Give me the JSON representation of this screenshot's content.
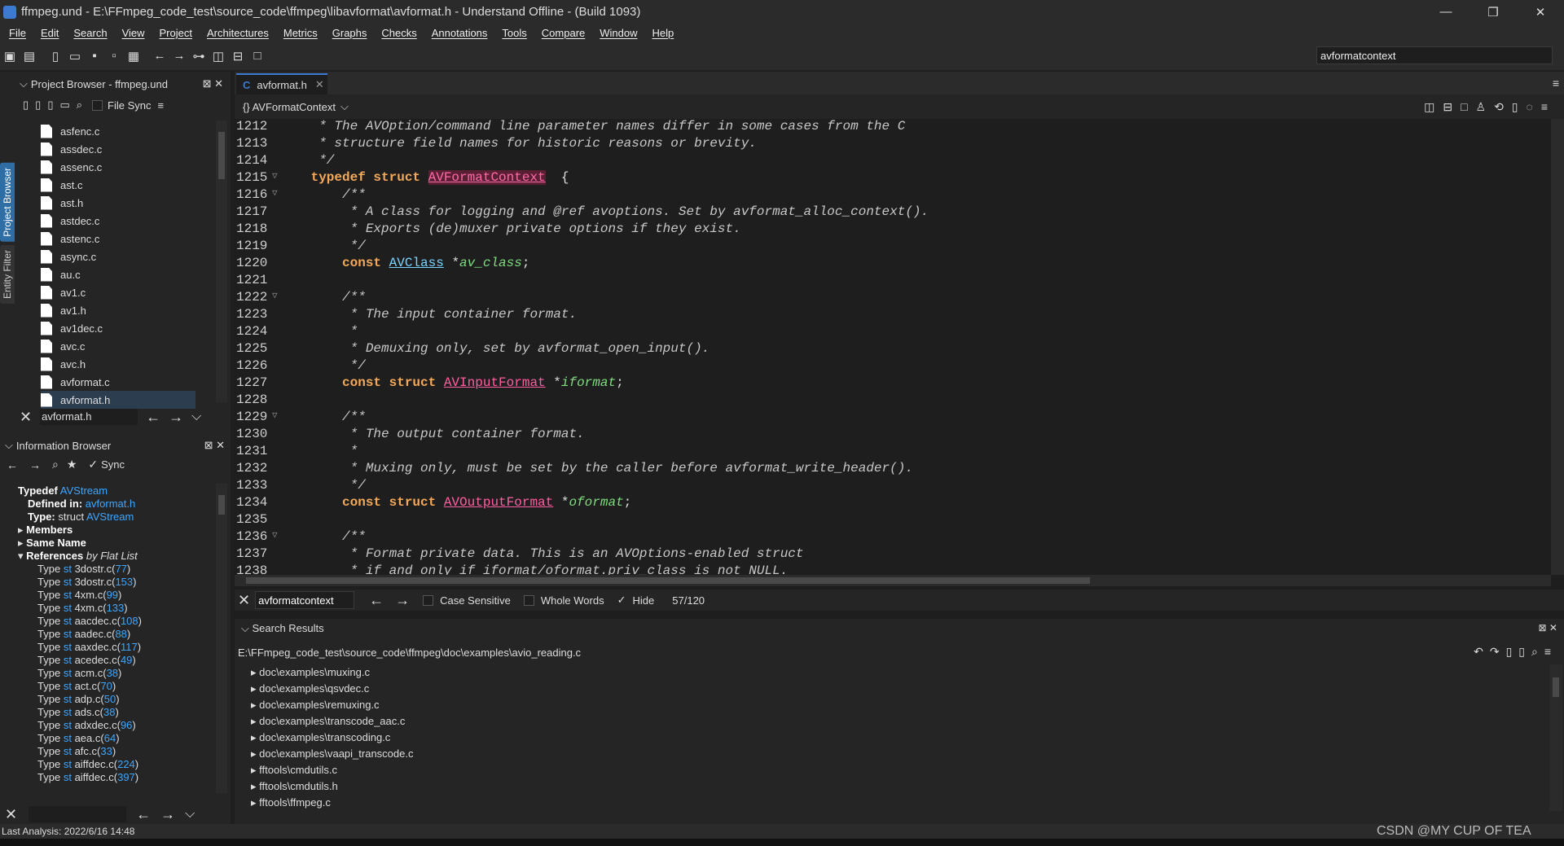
{
  "window": {
    "title": "ffmpeg.und - E:\\FFmpeg_code_test\\source_code\\ffmpeg\\libavformat\\avformat.h - Understand Offline - (Build 1093)",
    "minimize": "—",
    "restore": "❐",
    "close": "✕"
  },
  "menu": [
    "File",
    "Edit",
    "Search",
    "View",
    "Project",
    "Architectures",
    "Metrics",
    "Graphs",
    "Checks",
    "Annotations",
    "Tools",
    "Compare",
    "Window",
    "Help"
  ],
  "global_search": {
    "value": "avformatcontext"
  },
  "project_browser": {
    "title": "Project Browser - ffmpeg.und",
    "file_sync": "File Sync",
    "files": [
      "asfenc.c",
      "assdec.c",
      "assenc.c",
      "ast.c",
      "ast.h",
      "astdec.c",
      "astenc.c",
      "async.c",
      "au.c",
      "av1.c",
      "av1.h",
      "av1dec.c",
      "avc.c",
      "avc.h",
      "avformat.c",
      "avformat.h"
    ],
    "selected": "avformat.h",
    "filter_value": "avformat.h"
  },
  "vertical_tabs": [
    "Project Browser",
    "Entity Filter"
  ],
  "info_browser": {
    "title": "Information Browser",
    "sync": "Sync",
    "typedef_label": "Typedef",
    "typedef_name": "AVStream",
    "defined_in_label": "Defined in:",
    "defined_in": "avformat.h",
    "type_label": "Type:",
    "type_prefix": "struct",
    "type_name": "AVStream",
    "members": "Members",
    "same_name": "Same Name",
    "references": "References",
    "references_suffix": "by Flat List",
    "ref_rows": [
      {
        "label": "Type",
        "st": "st",
        "file": "3dostr.c",
        "line": "77"
      },
      {
        "label": "Type",
        "st": "st",
        "file": "3dostr.c",
        "line": "153"
      },
      {
        "label": "Type",
        "st": "st",
        "file": "4xm.c",
        "line": "99"
      },
      {
        "label": "Type",
        "st": "st",
        "file": "4xm.c",
        "line": "133"
      },
      {
        "label": "Type",
        "st": "st",
        "file": "aacdec.c",
        "line": "108"
      },
      {
        "label": "Type",
        "st": "st",
        "file": "aadec.c",
        "line": "88"
      },
      {
        "label": "Type",
        "st": "st",
        "file": "aaxdec.c",
        "line": "117"
      },
      {
        "label": "Type",
        "st": "st",
        "file": "acedec.c",
        "line": "49"
      },
      {
        "label": "Type",
        "st": "st",
        "file": "acm.c",
        "line": "38"
      },
      {
        "label": "Type",
        "st": "st",
        "file": "act.c",
        "line": "70"
      },
      {
        "label": "Type",
        "st": "st",
        "file": "adp.c",
        "line": "50"
      },
      {
        "label": "Type",
        "st": "st",
        "file": "ads.c",
        "line": "38"
      },
      {
        "label": "Type",
        "st": "st",
        "file": "adxdec.c",
        "line": "96"
      },
      {
        "label": "Type",
        "st": "st",
        "file": "aea.c",
        "line": "64"
      },
      {
        "label": "Type",
        "st": "st",
        "file": "afc.c",
        "line": "33"
      },
      {
        "label": "Type",
        "st": "st",
        "file": "aiffdec.c",
        "line": "224"
      },
      {
        "label": "Type",
        "st": "st",
        "file": "aiffdec.c",
        "line": "397"
      }
    ]
  },
  "editor": {
    "tab_label": "avformat.h",
    "scope": "{} AVFormatContext",
    "lines": [
      {
        "n": "1212",
        "fold": "",
        "parts": [
          [
            "cm",
            "  * The AVOption/command line parameter names differ in some cases from the C"
          ]
        ]
      },
      {
        "n": "1213",
        "fold": "",
        "parts": [
          [
            "cm",
            "  * structure field names for historic reasons or brevity."
          ]
        ]
      },
      {
        "n": "1214",
        "fold": "",
        "parts": [
          [
            "cm",
            "  */"
          ]
        ]
      },
      {
        "n": "1215",
        "fold": "▽",
        "parts": [
          [
            "kw",
            " typedef struct "
          ],
          [
            "hl",
            "AVFormatContext"
          ],
          [
            "",
            "  {"
          ]
        ]
      },
      {
        "n": "1216",
        "fold": "▽",
        "parts": [
          [
            "cm",
            "     /**"
          ]
        ]
      },
      {
        "n": "1217",
        "fold": "",
        "parts": [
          [
            "cm",
            "      * A class for logging and @ref avoptions. Set by avformat_alloc_context()."
          ]
        ]
      },
      {
        "n": "1218",
        "fold": "",
        "parts": [
          [
            "cm",
            "      * Exports (de)muxer private options if they exist."
          ]
        ]
      },
      {
        "n": "1219",
        "fold": "",
        "parts": [
          [
            "cm",
            "      */"
          ]
        ]
      },
      {
        "n": "1220",
        "fold": "",
        "parts": [
          [
            "kw",
            "     const "
          ],
          [
            "ty2",
            "AVClass"
          ],
          [
            "",
            " *"
          ],
          [
            "fld",
            "av_class"
          ],
          [
            "",
            ";"
          ]
        ]
      },
      {
        "n": "1221",
        "fold": "",
        "parts": []
      },
      {
        "n": "1222",
        "fold": "▽",
        "parts": [
          [
            "cm",
            "     /**"
          ]
        ]
      },
      {
        "n": "1223",
        "fold": "",
        "parts": [
          [
            "cm",
            "      * The input container format."
          ]
        ]
      },
      {
        "n": "1224",
        "fold": "",
        "parts": [
          [
            "cm",
            "      *"
          ]
        ]
      },
      {
        "n": "1225",
        "fold": "",
        "parts": [
          [
            "cm",
            "      * Demuxing only, set by avformat_open_input()."
          ]
        ]
      },
      {
        "n": "1226",
        "fold": "",
        "parts": [
          [
            "cm",
            "      */"
          ]
        ]
      },
      {
        "n": "1227",
        "fold": "",
        "parts": [
          [
            "kw",
            "     const struct "
          ],
          [
            "ty",
            "AVInputFormat"
          ],
          [
            "",
            " *"
          ],
          [
            "fld",
            "iformat"
          ],
          [
            "",
            ";"
          ]
        ]
      },
      {
        "n": "1228",
        "fold": "",
        "parts": []
      },
      {
        "n": "1229",
        "fold": "▽",
        "parts": [
          [
            "cm",
            "     /**"
          ]
        ]
      },
      {
        "n": "1230",
        "fold": "",
        "parts": [
          [
            "cm",
            "      * The output container format."
          ]
        ]
      },
      {
        "n": "1231",
        "fold": "",
        "parts": [
          [
            "cm",
            "      *"
          ]
        ]
      },
      {
        "n": "1232",
        "fold": "",
        "parts": [
          [
            "cm",
            "      * Muxing only, must be set by the caller before avformat_write_header()."
          ]
        ]
      },
      {
        "n": "1233",
        "fold": "",
        "parts": [
          [
            "cm",
            "      */"
          ]
        ]
      },
      {
        "n": "1234",
        "fold": "",
        "parts": [
          [
            "kw",
            "     const struct "
          ],
          [
            "ty",
            "AVOutputFormat"
          ],
          [
            "",
            " *"
          ],
          [
            "fld",
            "oformat"
          ],
          [
            "",
            ";"
          ]
        ]
      },
      {
        "n": "1235",
        "fold": "",
        "parts": []
      },
      {
        "n": "1236",
        "fold": "▽",
        "parts": [
          [
            "cm",
            "     /**"
          ]
        ]
      },
      {
        "n": "1237",
        "fold": "",
        "parts": [
          [
            "cm",
            "      * Format private data. This is an AVOptions-enabled struct"
          ]
        ]
      },
      {
        "n": "1238",
        "fold": "",
        "parts": [
          [
            "cm",
            "      * if and only if iformat/oformat.priv_class is not NULL."
          ]
        ]
      }
    ]
  },
  "find": {
    "value": "avformatcontext",
    "case_sensitive": "Case Sensitive",
    "whole_words": "Whole Words",
    "hide": "Hide",
    "count": "57/120"
  },
  "search_results": {
    "title": "Search Results",
    "path": "E:\\FFmpeg_code_test\\source_code\\ffmpeg\\doc\\examples\\avio_reading.c",
    "items": [
      "doc\\examples\\muxing.c",
      "doc\\examples\\qsvdec.c",
      "doc\\examples\\remuxing.c",
      "doc\\examples\\transcode_aac.c",
      "doc\\examples\\transcoding.c",
      "doc\\examples\\vaapi_transcode.c",
      "fftools\\cmdutils.c",
      "fftools\\cmdutils.h",
      "fftools\\ffmpeg.c"
    ]
  },
  "status": {
    "last_analysis": "Last Analysis: 2022/6/16 14:48"
  },
  "watermark": "CSDN @MY CUP OF TEA"
}
